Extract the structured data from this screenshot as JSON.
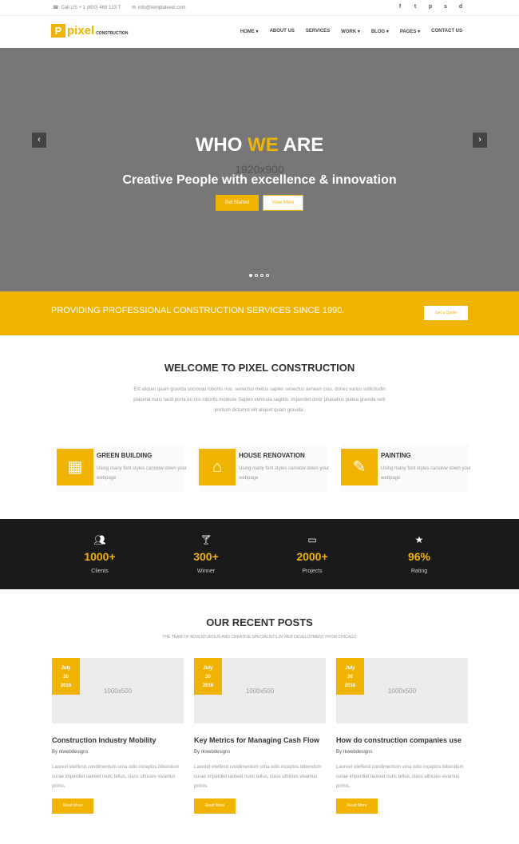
{
  "topbar": {
    "phone": "Call US + 1 (800) 469 123 T",
    "email": "info@templatexel.com",
    "socials": [
      "f",
      "t",
      "p",
      "s",
      "d"
    ]
  },
  "header": {
    "logo_mark": "P",
    "logo_text": "pixel",
    "logo_sub": "CONSTRUCTION",
    "nav": [
      "HOME ▾",
      "ABOUT US",
      "SERVICES",
      "WORK ▾",
      "BLOG ▾",
      "PAGES ▾",
      "CONTACT US"
    ]
  },
  "hero": {
    "title_1": "WHO ",
    "title_accent": "WE",
    "title_2": " ARE",
    "dimensions": "1920x900",
    "subtitle": "Creative People with excellence & innovation",
    "btn_start": "Get Started",
    "btn_more": "View More",
    "prev": "‹",
    "next": "›"
  },
  "band": {
    "text": "PROVIDING PROFESSIONAL CONSTRUCTION SERVICES SINCE 1990.",
    "button": "Get a Quote"
  },
  "welcome": {
    "title": "WELCOME TO PIXEL CONSTRUCTION",
    "text": "Elit aliquet quam gravida sociosqu lobortis nos. senectus metus sapien senectus aenean cras. donec varius sollicitudin placerat nunc taciti porta eu nisi lobortis molestie Sapien vehicula sagittis. imperdiet dolor phasellus platea gravida velit pretium dictumst elit aliquet quam gravida."
  },
  "services": [
    {
      "title": "GREEN BUILDING",
      "text": "Using many font styles canslow down your webpage"
    },
    {
      "title": "HOUSE RENOVATION",
      "text": "Using many font styles canslow down your webpage"
    },
    {
      "title": "PAINTING",
      "text": "Using many font styles canslow down your webpage"
    }
  ],
  "stats": [
    {
      "icon": "users-icon",
      "number": "1000+",
      "label": "Clients"
    },
    {
      "icon": "trophy-icon",
      "number": "300+",
      "label": "Winner"
    },
    {
      "icon": "monitor-icon",
      "number": "2000+",
      "label": "Projects"
    },
    {
      "icon": "star-icon",
      "number": "96%",
      "label": "Rating"
    }
  ],
  "posts_section": {
    "title": "OUR RECENT POSTS",
    "subtitle": "THE TEAM OF ADVENTUROUS AND CREATIVE SPECIALISTS IN WEB DEVELOPMENT FROM CHICAGO"
  },
  "posts": [
    {
      "month": "July",
      "day": "30",
      "year": "2016",
      "image_dim": "1000x500",
      "title": "Construction Industry Mobility",
      "author": "By rkwebdesigns",
      "excerpt": "Laoreet eleifend condimentum urna odio inceptos bibendum curae imperdiet laoreet nunc tellus, class ultricies vivamus primis.",
      "button": "Read More"
    },
    {
      "month": "July",
      "day": "30",
      "year": "2016",
      "image_dim": "1000x500",
      "title": "Key Metrics for Managing Cash Flow",
      "author": "By rkwebdesigns",
      "excerpt": "Laoreet eleifend condimentum urna odio inceptos bibendum curae imperdiet laoreet nunc tellus, class ultricies vivamus primis.",
      "button": "Read More"
    },
    {
      "month": "July",
      "day": "30",
      "year": "2016",
      "image_dim": "1000x500",
      "title": "How do construction companies use",
      "author": "By rkwebdesigns",
      "excerpt": "Laoreet eleifend condimentum urna odio inceptos bibendum curae imperdiet laoreet nunc tellus, class ultricies vivamus primis.",
      "button": "Read More"
    }
  ],
  "colors": {
    "accent": "#f0b400",
    "dark": "#1a1a1a",
    "hero": "#777777"
  }
}
